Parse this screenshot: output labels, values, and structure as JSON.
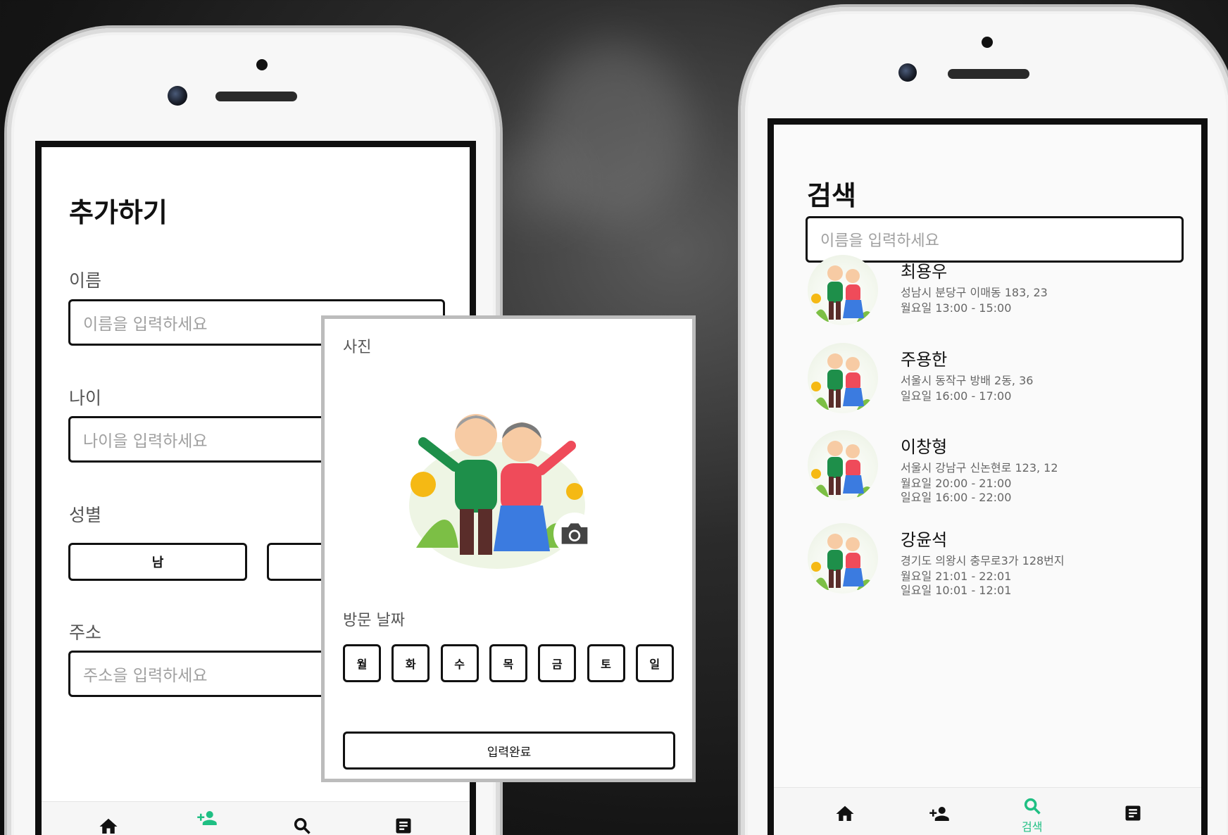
{
  "left_screen": {
    "title": "추가하기",
    "fields": [
      {
        "label": "이름",
        "placeholder": "이름을 입력하세요"
      },
      {
        "label": "나이",
        "placeholder": "나이을 입력하세요"
      },
      {
        "label": "성별"
      },
      {
        "label": "주소",
        "placeholder": "주소을 입력하세요"
      }
    ],
    "gender_male": "남"
  },
  "popup": {
    "photo_label": "사진",
    "visit_label": "방문 날짜",
    "days": [
      "월",
      "화",
      "수",
      "목",
      "금",
      "토",
      "일"
    ],
    "submit": "입력완료"
  },
  "right_screen": {
    "title": "검색",
    "search_placeholder": "이름을 입력하세요",
    "results": [
      {
        "name": "최용우",
        "address": "성남시 분당구 이매동 183, 23",
        "times": [
          "월요일 13:00 - 15:00"
        ]
      },
      {
        "name": "주용한",
        "address": "서울시 동작구 방배 2동, 36",
        "times": [
          "일요일 16:00 - 17:00"
        ]
      },
      {
        "name": "이창형",
        "address": "서울시 강남구 신논현로 123, 12",
        "times": [
          "월요일 20:00 - 21:00",
          "일요일 16:00 - 22:00"
        ]
      },
      {
        "name": "강윤석",
        "address": "경기도 의왕시 충무로3가 128번지",
        "times": [
          "월요일 21:01 - 22:01",
          "일요일 10:01 - 12:01"
        ]
      }
    ],
    "tabs": {
      "search_label": "검색"
    }
  },
  "colors": {
    "accent": "#1fbf83",
    "text": "#111111",
    "muted": "#666666",
    "border": "#111111"
  },
  "icons": [
    "home-icon",
    "add-user-icon",
    "search-icon",
    "list-icon",
    "camera-icon"
  ]
}
